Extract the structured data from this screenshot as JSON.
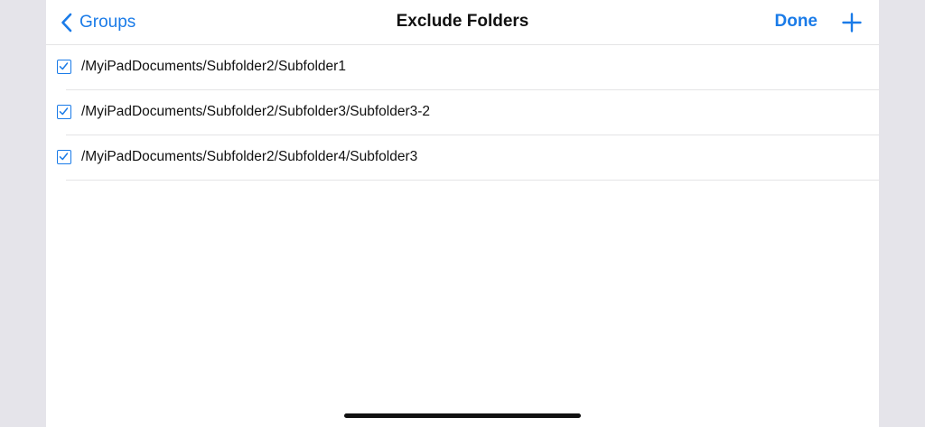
{
  "navbar": {
    "back_label": "Groups",
    "title": "Exclude Folders",
    "done_label": "Done",
    "back_icon": "chevron-left-icon",
    "add_icon": "plus-icon"
  },
  "folders": [
    {
      "path": "/MyiPadDocuments/Subfolder2/Subfolder1",
      "checked": true
    },
    {
      "path": "/MyiPadDocuments/Subfolder2/Subfolder3/Subfolder3-2",
      "checked": true
    },
    {
      "path": "/MyiPadDocuments/Subfolder2/Subfolder4/Subfolder3",
      "checked": true
    }
  ],
  "colors": {
    "accent": "#1a7be8",
    "background": "#e5e4ea",
    "sheet": "#ffffff",
    "separator": "#e4e4e6",
    "text": "#111111"
  }
}
